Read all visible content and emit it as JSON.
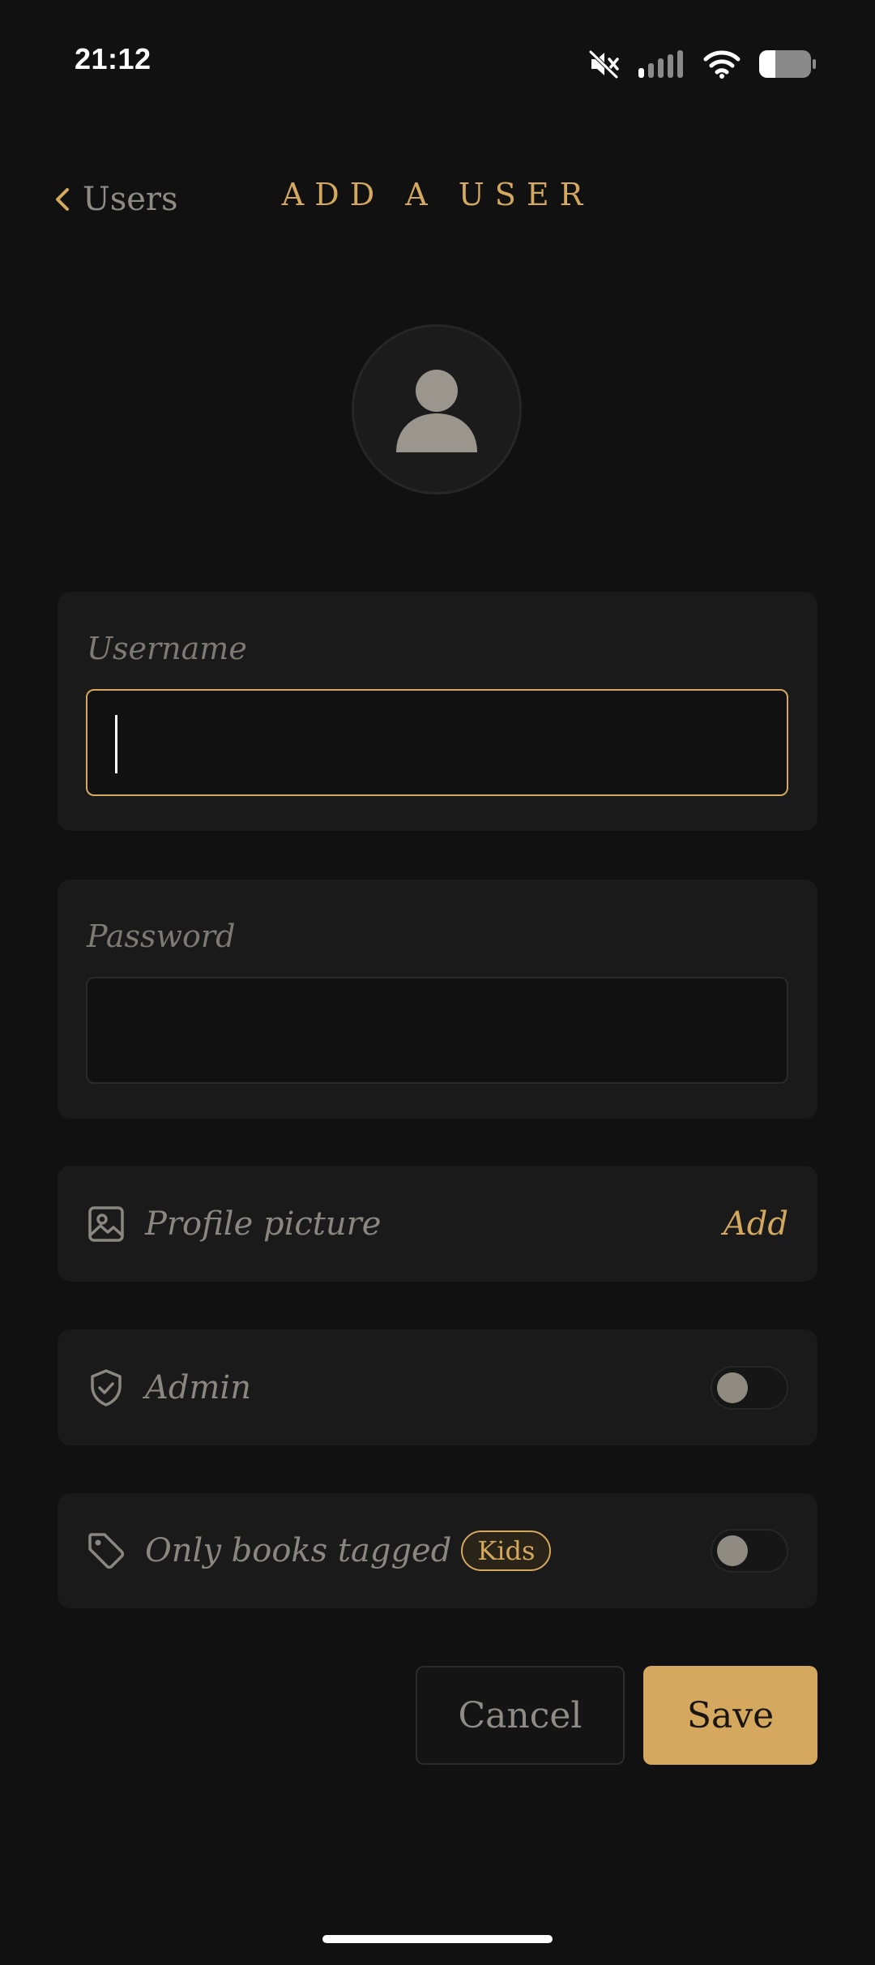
{
  "status_bar": {
    "time": "21:12",
    "icons": [
      "mute-icon",
      "signal-icon",
      "wifi-icon",
      "battery-icon"
    ]
  },
  "header": {
    "back_label": "Users",
    "title": "ADD A USER"
  },
  "avatar": {
    "icon": "user-placeholder-icon"
  },
  "form": {
    "username": {
      "label": "Username",
      "value": "",
      "focused": true
    },
    "password": {
      "label": "Password",
      "value": ""
    },
    "profile_picture": {
      "icon": "image-icon",
      "label": "Profile picture",
      "action_label": "Add"
    },
    "admin": {
      "icon": "shield-check-icon",
      "label": "Admin",
      "enabled": false
    },
    "tag_filter": {
      "icon": "tag-icon",
      "label": "Only books tagged",
      "tag": "Kids",
      "enabled": false
    }
  },
  "actions": {
    "cancel_label": "Cancel",
    "save_label": "Save"
  },
  "colors": {
    "background": "#111111",
    "card": "#1a1a1a",
    "accent": "#d4a85e",
    "muted_text": "#8a8780"
  }
}
